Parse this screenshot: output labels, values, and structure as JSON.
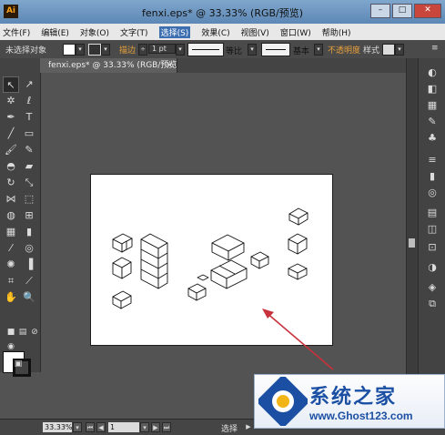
{
  "window": {
    "title": "fenxi.eps* @ 33.33% (RGB/预览)",
    "app_icon": "Ai"
  },
  "menubar": {
    "items": [
      "文件(F)",
      "编辑(E)",
      "对象(O)",
      "文字(T)",
      "选择(S)",
      "效果(C)",
      "视图(V)",
      "窗口(W)",
      "帮助(H)"
    ]
  },
  "control": {
    "selection": "未选择对象",
    "stroke_label": "描边",
    "stroke_value": "1 pt",
    "ratio_label": "等比",
    "basic_label": "基本",
    "opacity_label": "不透明度",
    "style_label": "样式"
  },
  "document_tab": {
    "label": "fenxi.eps* @ 33.33% (RGB/预览)",
    "close": "×"
  },
  "status": {
    "zoom": "33.33%",
    "page": "1",
    "tool": "选择"
  },
  "watermark": {
    "text": "系统之家",
    "url": "www.Ghost123.com"
  },
  "colors": {
    "accent_orange": "#e8a03a",
    "arrow": "#c8323c",
    "watermark_blue": "#1b4fa3"
  }
}
